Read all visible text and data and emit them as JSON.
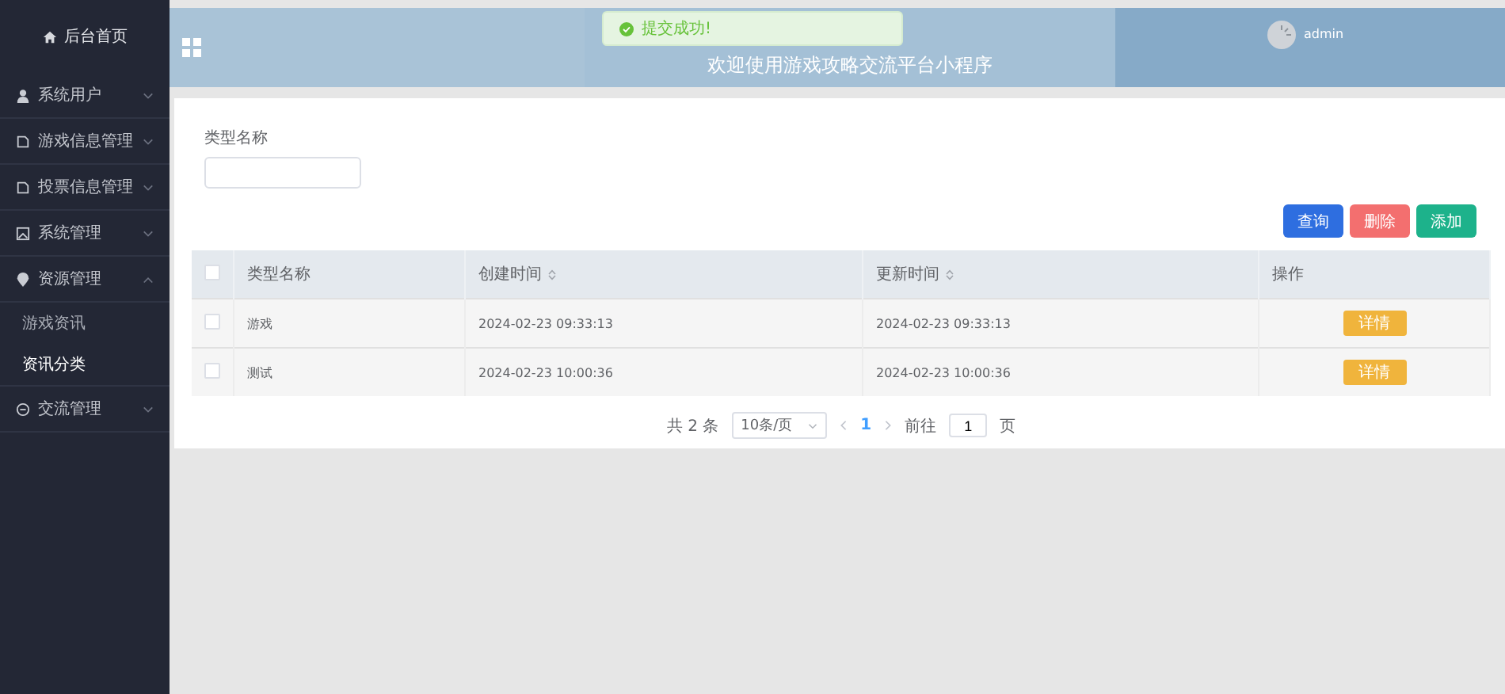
{
  "sidebar": {
    "home": "后台首页",
    "items": [
      {
        "label": "系统用户",
        "expanded": false
      },
      {
        "label": "游戏信息管理",
        "expanded": false
      },
      {
        "label": "投票信息管理",
        "expanded": false
      },
      {
        "label": "系统管理",
        "expanded": false
      },
      {
        "label": "资源管理",
        "expanded": true,
        "children": [
          {
            "label": "游戏资讯",
            "selected": false
          },
          {
            "label": "资讯分类",
            "selected": true
          }
        ]
      },
      {
        "label": "交流管理",
        "expanded": false
      }
    ]
  },
  "header": {
    "title": "欢迎使用游戏攻略交流平台小程序",
    "user": "admin"
  },
  "toast": {
    "text": "提交成功!"
  },
  "filter": {
    "label": "类型名称"
  },
  "buttons": [
    {
      "label": "查询",
      "kind": "query"
    },
    {
      "label": "删除",
      "kind": "delete"
    },
    {
      "label": "添加",
      "kind": "add"
    }
  ],
  "table": {
    "select_all": {
      "checked": false
    },
    "columns": [
      {
        "label": "类型名称",
        "sortable": false
      },
      {
        "label": "创建时间",
        "sortable": true
      },
      {
        "label": "更新时间",
        "sortable": true
      },
      {
        "label": "操作",
        "sortable": false
      }
    ],
    "rows": [
      {
        "checked": false,
        "cells": [
          "游戏",
          "2024-02-23 09:33:13",
          "2024-02-23 09:33:13"
        ],
        "action": "详情"
      },
      {
        "checked": false,
        "cells": [
          "测试",
          "2024-02-23 10:00:36",
          "2024-02-23 10:00:36"
        ],
        "action": "详情"
      }
    ]
  },
  "pagination": {
    "total": "共 2 条",
    "page_size": "10条/页",
    "pages": [
      {
        "label": "1",
        "selected": true
      }
    ],
    "goto_label": "前往",
    "goto_value": "1",
    "goto_suffix": "页"
  }
}
